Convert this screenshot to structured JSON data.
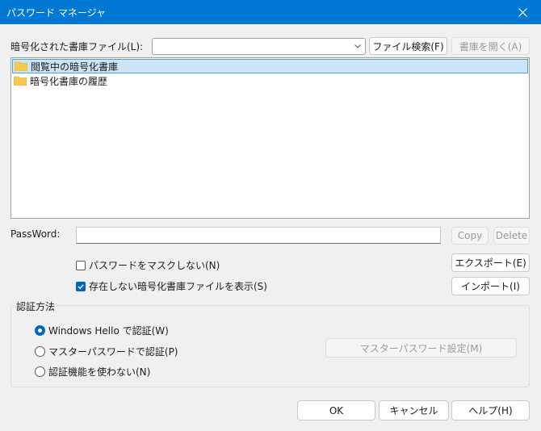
{
  "window": {
    "title": "パスワード マネージャ"
  },
  "file_row": {
    "label": "暗号化された書庫ファイル(L):",
    "combo_value": "",
    "search_button": "ファイル検索(F)",
    "open_button": "書庫を開く(A)"
  },
  "tree": {
    "items": [
      {
        "label": "閲覧中の暗号化書庫",
        "selected": true
      },
      {
        "label": "暗号化書庫の履歴",
        "selected": false
      }
    ]
  },
  "password": {
    "label": "PassWord:",
    "value": "",
    "copy_button": "Copy",
    "delete_button": "Delete"
  },
  "options": {
    "no_mask": {
      "label": "パスワードをマスクしない(N)",
      "checked": false
    },
    "show_missing": {
      "label": "存在しない暗号化書庫ファイルを表示(S)",
      "checked": true
    },
    "export_button": "エクスポート(E)",
    "import_button": "インポート(I)"
  },
  "auth": {
    "title": "認証方法",
    "options": [
      {
        "label": "Windows Hello で認証(W)",
        "selected": true
      },
      {
        "label": "マスターパスワードで認証(P)",
        "selected": false
      },
      {
        "label": "認証機能を使わない(N)",
        "selected": false
      }
    ],
    "master_button": "マスターパスワード設定(M)"
  },
  "footer": {
    "ok": "OK",
    "cancel": "キャンセル",
    "help": "ヘルプ(H)"
  },
  "colors": {
    "accent": "#0078d4",
    "selection": "#cce4f7",
    "folder": "#f6c94a"
  }
}
